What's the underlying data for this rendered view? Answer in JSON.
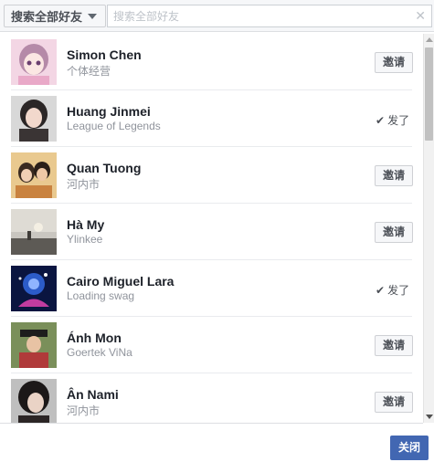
{
  "search": {
    "filter_label": "搜索全部好友",
    "placeholder": "搜索全部好友",
    "value": ""
  },
  "friends": [
    {
      "name": "Simon Chen",
      "subtitle": "个体经营",
      "action": "invite",
      "button_label": "邀请",
      "avatar": "anime-girl-avatar"
    },
    {
      "name": "Huang Jinmei",
      "subtitle": "League of Legends",
      "action": "invited",
      "invited_label": "发了",
      "avatar": "woman-portrait-avatar"
    },
    {
      "name": "Quan Tuong",
      "subtitle": "河内市",
      "action": "invite",
      "button_label": "邀请",
      "avatar": "couple-selfie-avatar"
    },
    {
      "name": "Hà My",
      "subtitle": "Ylinkee",
      "action": "invite",
      "button_label": "邀请",
      "avatar": "sunset-silhouette-avatar"
    },
    {
      "name": "Cairo Miguel Lara",
      "subtitle": "Loading swag",
      "action": "invited",
      "invited_label": "发了",
      "avatar": "galaxy-glow-avatar"
    },
    {
      "name": "Ánh Mon",
      "subtitle": "Goertek ViNa",
      "action": "invite",
      "button_label": "邀请",
      "avatar": "graduate-avatar"
    },
    {
      "name": "Ân Nami",
      "subtitle": "河内市",
      "action": "invite",
      "button_label": "邀请",
      "avatar": "dark-hair-girl-avatar"
    }
  ],
  "footer": {
    "close_label": "关闭"
  },
  "icons": {
    "clear": "close-icon",
    "filter_caret": "caret-down-icon",
    "invited_check": "check-icon"
  },
  "colors": {
    "primary_button": "#4267b2",
    "text_primary": "#1d2129",
    "text_secondary": "#90949c"
  }
}
